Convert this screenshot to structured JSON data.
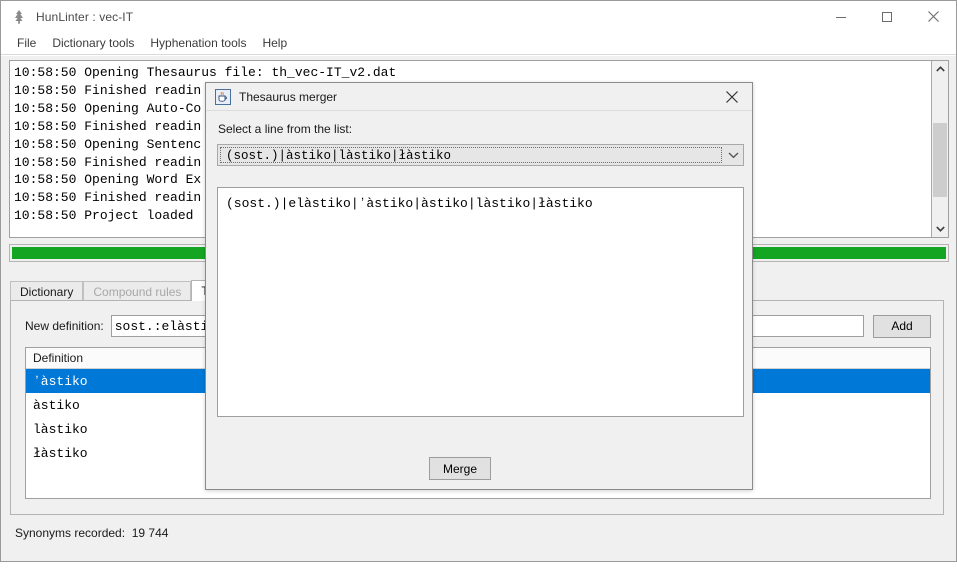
{
  "window": {
    "title": "HunLinter : vec-IT",
    "icon": "app-tree-icon",
    "controls": {
      "minimize": "minimize-icon",
      "maximize": "maximize-icon",
      "close": "close-icon"
    }
  },
  "menu": {
    "items": [
      {
        "label": "File"
      },
      {
        "label": "Dictionary tools"
      },
      {
        "label": "Hyphenation tools"
      },
      {
        "label": "Help"
      }
    ]
  },
  "log": {
    "lines": [
      "10:58:50 Opening Thesaurus file: th_vec-IT_v2.dat",
      "10:58:50 Finished readin",
      "10:58:50 Opening Auto-Co",
      "10:58:50 Finished readin",
      "10:58:50 Opening Sentenc",
      "10:58:50 Finished readin",
      "10:58:50 Opening Word Ex",
      "10:58:50 Finished readin",
      "10:58:50 Project loaded"
    ],
    "scrollbar": {
      "up_arrow": "chevron-up-icon",
      "down_arrow": "chevron-down-icon"
    }
  },
  "progress": {
    "percent": 100,
    "color": "#14a523"
  },
  "tabs": [
    {
      "label": "Dictionary",
      "state": "normal"
    },
    {
      "label": "Compound rules",
      "state": "disabled"
    },
    {
      "label": "Thesaurus",
      "state": "active"
    }
  ],
  "thesaurus_panel": {
    "new_definition_label": "New definition:",
    "new_definition_value": "sost.:elàstiko",
    "add_label": "Add",
    "table": {
      "header": "Definition",
      "rows": [
        {
          "value": "ʼàstiko",
          "selected": true
        },
        {
          "value": "àstiko",
          "selected": false
        },
        {
          "value": "làstiko",
          "selected": false
        },
        {
          "value": "łàstiko",
          "selected": false
        }
      ]
    }
  },
  "status_bar": {
    "text": "Synonyms recorded:  19 744"
  },
  "dialog": {
    "title": "Thesaurus merger",
    "icon": "java-coffee-cup-icon",
    "close_icon": "close-icon",
    "prompt": "Select a line from the list:",
    "combo": {
      "selected_value": "(sost.)|àstiko|làstiko|łàstiko",
      "arrow_icon": "chevron-down-icon"
    },
    "preview_text": "(sost.)|elàstiko|ʼàstiko|àstiko|làstiko|łàstiko",
    "merge_label": "Merge"
  },
  "colors": {
    "selection_blue": "#0078d7",
    "progress_green": "#14a523",
    "window_bg": "#f0f0f0"
  }
}
